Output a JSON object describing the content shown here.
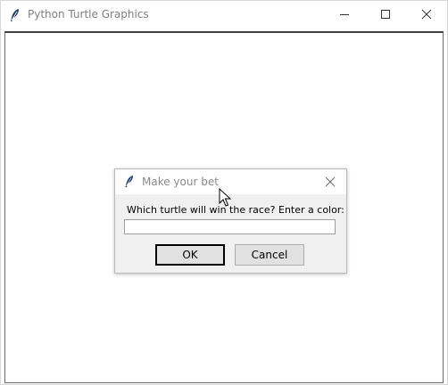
{
  "window": {
    "title": "Python Turtle Graphics",
    "icon": "feather-icon",
    "controls": [
      "minimize-icon",
      "maximize-icon",
      "close-icon"
    ]
  },
  "dialog": {
    "title": "Make your bet",
    "icon": "feather-icon",
    "prompt": "Which turtle will win the race? Enter a color:",
    "input_value": "",
    "ok_label": "OK",
    "cancel_label": "Cancel"
  }
}
